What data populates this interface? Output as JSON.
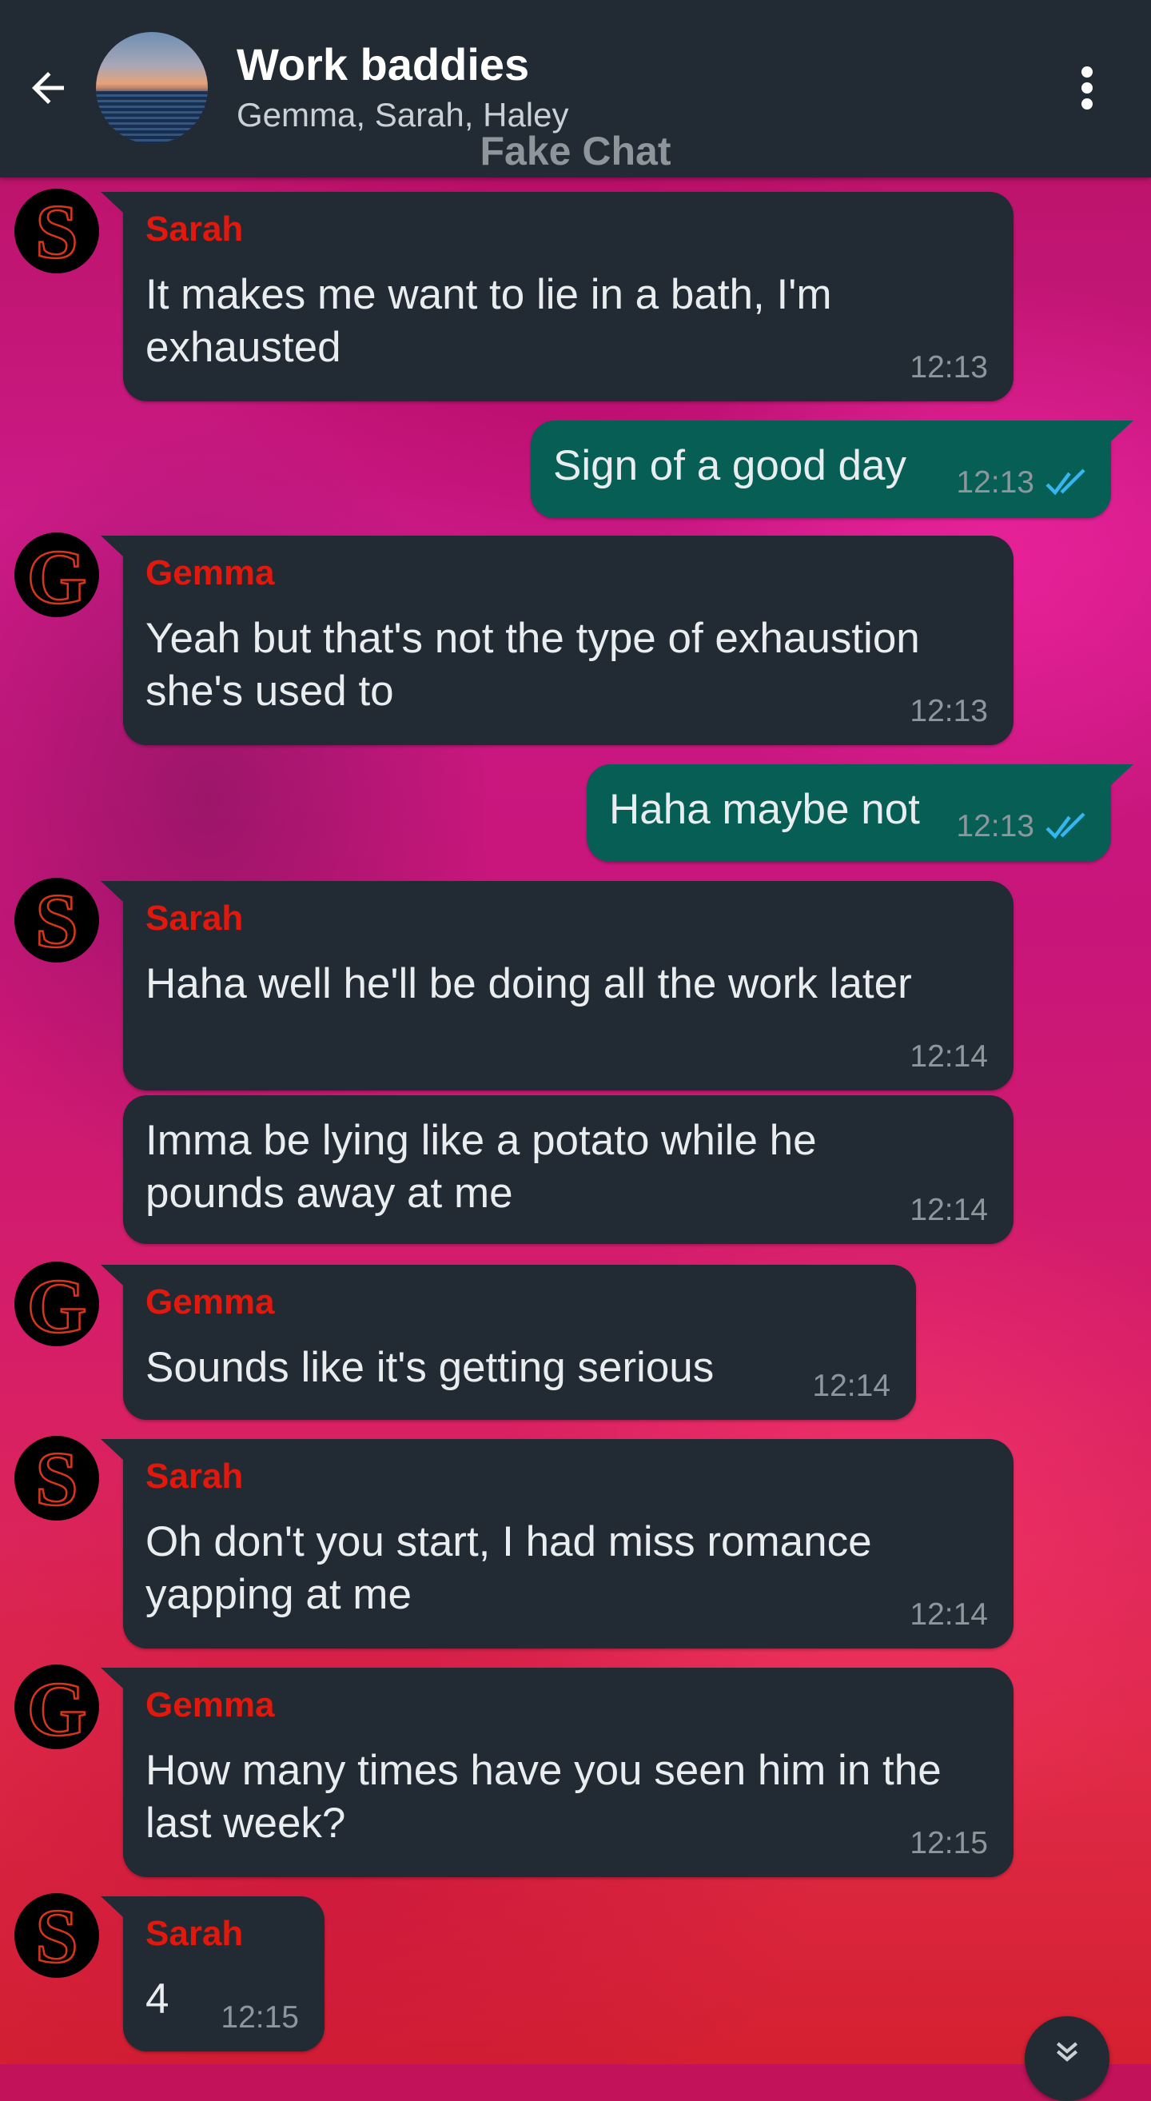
{
  "header": {
    "title": "Work baddies",
    "members": "Gemma, Sarah, Haley",
    "watermark": "Fake Chat",
    "back_icon": "arrow-left-icon",
    "menu_icon": "more-vert-icon"
  },
  "colors": {
    "header_bg": "#222b33",
    "incoming_bubble": "#222b33",
    "outgoing_bubble": "#075e54",
    "sender_name": "#e3180c",
    "read_ticks": "#34b7f1"
  },
  "messages": [
    {
      "sender": "Sarah",
      "text": "It makes me want to lie in a bath, I'm\nexhausted",
      "time": "12:13"
    },
    {
      "text": "Sign of a good day",
      "time": "12:13",
      "status": "read"
    },
    {
      "sender": "Gemma",
      "text": "Yeah but that's not the type of exhaustion\nshe's used to",
      "time": "12:13"
    },
    {
      "text": "Haha maybe not",
      "time": "12:13",
      "status": "read"
    },
    {
      "sender": "Sarah",
      "text": "Haha well he'll be doing all the work later",
      "time": "12:14"
    },
    {
      "text": "Imma be lying like a potato while he\npounds away at me",
      "time": "12:14"
    },
    {
      "sender": "Gemma",
      "text": "Sounds like it's getting serious",
      "time": "12:14"
    },
    {
      "sender": "Sarah",
      "text": "Oh don't you start, I had miss romance\nyapping at me",
      "time": "12:14"
    },
    {
      "sender": "Gemma",
      "text": "How many times have you seen him in the\nlast week?",
      "time": "12:15"
    },
    {
      "sender": "Sarah",
      "text": "4",
      "time": "12:15"
    }
  ],
  "scroll_button_icon": "chevron-double-down-icon"
}
